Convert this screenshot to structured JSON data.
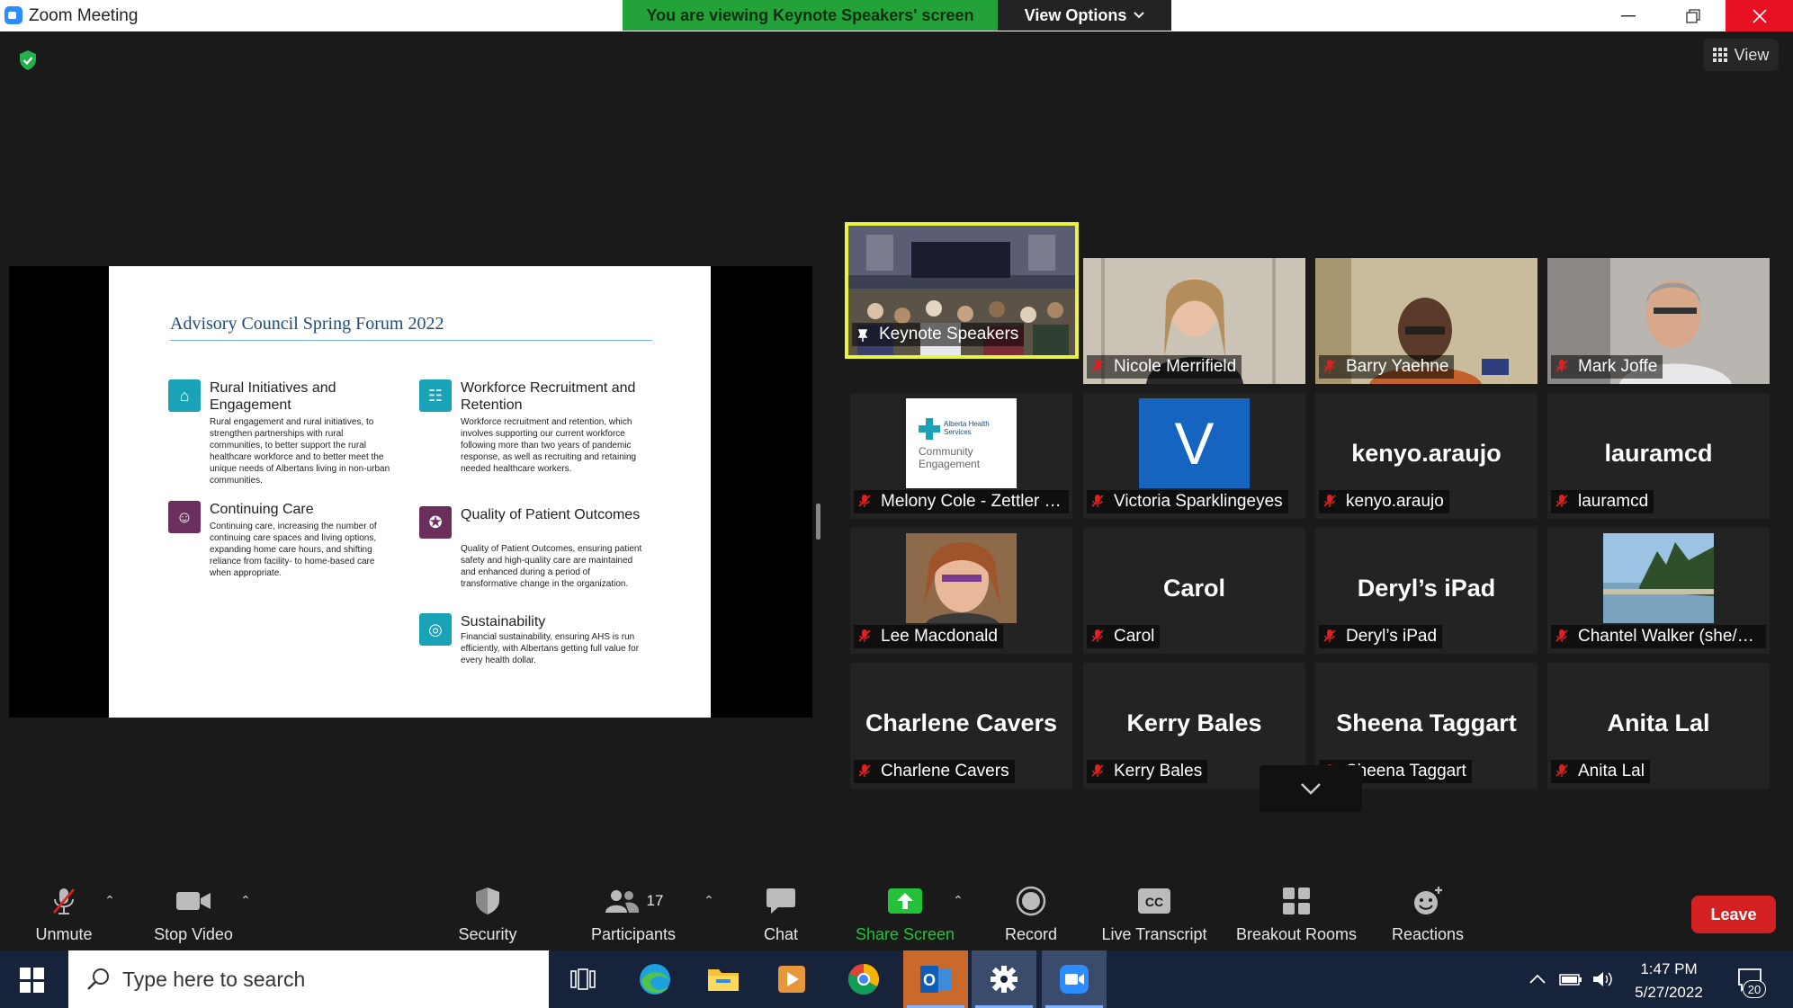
{
  "window": {
    "title": "Zoom Meeting"
  },
  "banner": {
    "text": "You are viewing Keynote Speakers' screen",
    "view_options": "View Options"
  },
  "view_button": "View",
  "slide": {
    "title": "Advisory Council Spring Forum 2022",
    "items": [
      {
        "heading": "Rural Initiatives and Engagement",
        "body": "Rural engagement and rural initiatives, to strengthen partnerships with rural communities, to better support the rural healthcare workforce and to better meet the unique needs of Albertans living in non-urban communities."
      },
      {
        "heading": "Continuing Care",
        "body": "Continuing care, increasing the number of continuing care spaces and living options, expanding home care hours, and shifting reliance from facility- to home-based care when appropriate."
      },
      {
        "heading": "Workforce Recruitment and Retention",
        "body": "Workforce recruitment and retention, which involves supporting our current workforce following more than two years of pandemic response, as well as recruiting and retaining needed healthcare workers."
      },
      {
        "heading": "Quality of Patient Outcomes",
        "body": "Quality of Patient Outcomes, ensuring patient safety and high-quality care are maintained and enhanced during a period of transformative change in the organization."
      },
      {
        "heading": "Sustainability",
        "body": "Financial sustainability, ensuring AHS is run efficiently, with Albertans getting full value for every health dollar."
      }
    ]
  },
  "participants": [
    {
      "label": "Keynote Speakers",
      "big": ""
    },
    {
      "label": "Nicole Merrifield",
      "big": ""
    },
    {
      "label": "Barry Yaehne",
      "big": ""
    },
    {
      "label": "Mark Joffe",
      "big": ""
    },
    {
      "label": "Melony Cole - Zettler (...",
      "big": "",
      "logo_line1": "Alberta Health Services",
      "logo_line2": "Community Engagement"
    },
    {
      "label": "Victoria Sparklingeyes",
      "big": "V"
    },
    {
      "label": "kenyo.araujo",
      "big": "kenyo.araujo"
    },
    {
      "label": "lauramcd",
      "big": "lauramcd"
    },
    {
      "label": "Lee Macdonald",
      "big": ""
    },
    {
      "label": "Carol",
      "big": "Carol"
    },
    {
      "label": "Deryl’s iPad",
      "big": "Deryl’s iPad"
    },
    {
      "label": "Chantel Walker (she/h...",
      "big": ""
    },
    {
      "label": "Charlene Cavers",
      "big": "Charlene Cavers"
    },
    {
      "label": "Kerry Bales",
      "big": "Kerry Bales"
    },
    {
      "label": "Sheena Taggart",
      "big": "Sheena Taggart"
    },
    {
      "label": "Anita Lal",
      "big": "Anita Lal"
    }
  ],
  "toolbar": {
    "unmute": "Unmute",
    "stop_video": "Stop Video",
    "security": "Security",
    "participants": "Participants",
    "participants_count": "17",
    "chat": "Chat",
    "share_screen": "Share Screen",
    "record": "Record",
    "live_transcript": "Live Transcript",
    "breakout_rooms": "Breakout Rooms",
    "reactions": "Reactions",
    "leave": "Leave"
  },
  "taskbar": {
    "search_placeholder": "Type here to search",
    "time": "1:47 PM",
    "date": "5/27/2022",
    "notifications": "20"
  },
  "colors": {
    "share_green": "#23a23a",
    "leave_red": "#d32020",
    "active_speaker": "#e9f53b",
    "mic_muted": "#e02020"
  }
}
